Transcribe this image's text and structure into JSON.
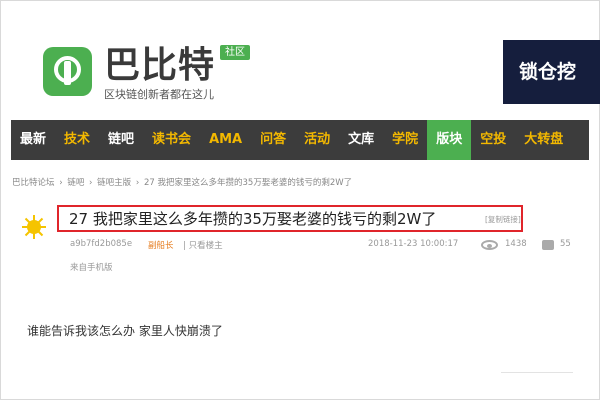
{
  "header": {
    "logo_title": "巴比特",
    "badge": "社区",
    "subtitle": "区块链创新者都在这儿",
    "ad_text": "锁仓挖"
  },
  "nav": [
    {
      "label": "最新",
      "style": "white"
    },
    {
      "label": "技术",
      "style": "yellow"
    },
    {
      "label": "链吧",
      "style": "white"
    },
    {
      "label": "读书会",
      "style": "yellow"
    },
    {
      "label": "AMA",
      "style": "yellow"
    },
    {
      "label": "问答",
      "style": "yellow"
    },
    {
      "label": "活动",
      "style": "yellow"
    },
    {
      "label": "文库",
      "style": "white"
    },
    {
      "label": "学院",
      "style": "yellow"
    },
    {
      "label": "版块",
      "style": "active"
    },
    {
      "label": "空投",
      "style": "yellow"
    },
    {
      "label": "大转盘",
      "style": "yellow"
    }
  ],
  "breadcrumb": [
    "巴比特论坛",
    "›",
    "链吧",
    "›",
    "链吧主版",
    "›",
    "27 我把家里这么多年攒的35万娶老婆的钱亏的剩2W了"
  ],
  "post": {
    "title": "27 我把家里这么多年攒的35万娶老婆的钱亏的剩2W了",
    "copy_link": "[复制链接]",
    "author": "a9b7fd2b085e",
    "role": "副船长",
    "owner_only": "只看楼主",
    "sep": "|",
    "date": "2018-11-23 10:00:17",
    "views": "1438",
    "replies": "55",
    "source": "来自手机版",
    "content": "谁能告诉我该怎么办  家里人快崩溃了"
  },
  "colors": {
    "accent_green": "#4caf50",
    "nav_bg": "#3c3c3c",
    "nav_yellow": "#f3b800",
    "highlight_red": "#e0252b"
  }
}
